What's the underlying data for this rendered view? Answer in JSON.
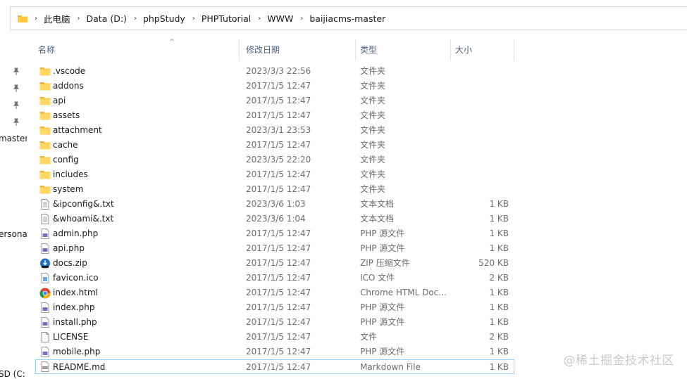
{
  "address": {
    "crumbs": [
      "此电脑",
      "Data (D:)",
      "phpStudy",
      "PHPTutorial",
      "WWW",
      "baijiacms-master"
    ]
  },
  "leftnav": {
    "labels": [
      "master",
      "ersona",
      "SD (C:"
    ]
  },
  "columns": {
    "name": "名称",
    "date": "修改日期",
    "type": "类型",
    "size": "大小"
  },
  "files": [
    {
      "name": ".vscode",
      "date": "2023/3/3 22:56",
      "type": "文件夹",
      "size": "",
      "icon": "folder-icon"
    },
    {
      "name": "addons",
      "date": "2017/1/5 12:47",
      "type": "文件夹",
      "size": "",
      "icon": "folder-icon"
    },
    {
      "name": "api",
      "date": "2017/1/5 12:47",
      "type": "文件夹",
      "size": "",
      "icon": "folder-icon"
    },
    {
      "name": "assets",
      "date": "2017/1/5 12:47",
      "type": "文件夹",
      "size": "",
      "icon": "folder-icon"
    },
    {
      "name": "attachment",
      "date": "2023/3/1 23:53",
      "type": "文件夹",
      "size": "",
      "icon": "folder-icon"
    },
    {
      "name": "cache",
      "date": "2017/1/5 12:47",
      "type": "文件夹",
      "size": "",
      "icon": "folder-icon"
    },
    {
      "name": "config",
      "date": "2023/3/5 22:20",
      "type": "文件夹",
      "size": "",
      "icon": "folder-icon"
    },
    {
      "name": "includes",
      "date": "2017/1/5 12:47",
      "type": "文件夹",
      "size": "",
      "icon": "folder-icon"
    },
    {
      "name": "system",
      "date": "2017/1/5 12:47",
      "type": "文件夹",
      "size": "",
      "icon": "folder-icon"
    },
    {
      "name": "&ipconfig&.txt",
      "date": "2023/3/6 1:03",
      "type": "文本文档",
      "size": "1 KB",
      "icon": "text-file-icon"
    },
    {
      "name": "&whoami&.txt",
      "date": "2023/3/6 1:04",
      "type": "文本文档",
      "size": "1 KB",
      "icon": "text-file-icon"
    },
    {
      "name": "admin.php",
      "date": "2017/1/5 12:47",
      "type": "PHP 源文件",
      "size": "1 KB",
      "icon": "php-file-icon"
    },
    {
      "name": "api.php",
      "date": "2017/1/5 12:47",
      "type": "PHP 源文件",
      "size": "1 KB",
      "icon": "php-file-icon"
    },
    {
      "name": "docs.zip",
      "date": "2017/1/5 12:47",
      "type": "ZIP 压缩文件",
      "size": "520 KB",
      "icon": "zip-file-icon"
    },
    {
      "name": "favicon.ico",
      "date": "2017/1/5 12:47",
      "type": "ICO 文件",
      "size": "2 KB",
      "icon": "ico-file-icon"
    },
    {
      "name": "index.html",
      "date": "2017/1/5 12:47",
      "type": "Chrome HTML Doc...",
      "size": "1 KB",
      "icon": "chrome-icon"
    },
    {
      "name": "index.php",
      "date": "2017/1/5 12:47",
      "type": "PHP 源文件",
      "size": "1 KB",
      "icon": "php-file-icon"
    },
    {
      "name": "install.php",
      "date": "2017/1/5 12:47",
      "type": "PHP 源文件",
      "size": "1 KB",
      "icon": "php-file-icon"
    },
    {
      "name": "LICENSE",
      "date": "2017/1/5 12:47",
      "type": "文件",
      "size": "2 KB",
      "icon": "blank-file-icon"
    },
    {
      "name": "mobile.php",
      "date": "2017/1/5 12:47",
      "type": "PHP 源文件",
      "size": "1 KB",
      "icon": "php-file-icon"
    },
    {
      "name": "README.md",
      "date": "2017/1/5 12:47",
      "type": "Markdown File",
      "size": "1 KB",
      "icon": "markdown-file-icon",
      "selected": true
    }
  ],
  "watermark": "@稀土掘金技术社区",
  "colors": {
    "folder": "#ffc83d",
    "folder_dark": "#e8a83b",
    "header_text": "#4c607a",
    "selection_border": "#99d1ff",
    "php": "#7a6fc4"
  }
}
